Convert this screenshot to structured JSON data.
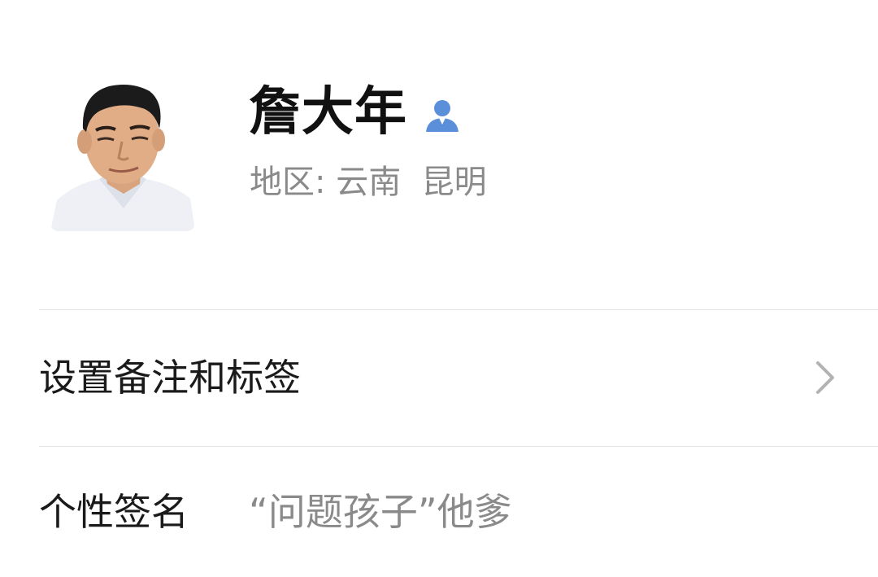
{
  "profile": {
    "name": "詹大年",
    "region_label": "地区:",
    "region_province": "云南",
    "region_city": "昆明",
    "gender_icon": "male-user-icon",
    "avatar_icon": "avatar-photo"
  },
  "rows": {
    "remark_label": "设置备注和标签",
    "remark_icon": "chevron-right-icon",
    "signature_label": "个性签名",
    "signature_value": "“问题孩子”他爹"
  },
  "colors": {
    "gender_icon": "#5b8fd9",
    "secondary_text": "#8a8a8a",
    "divider": "#e3e3e3"
  }
}
